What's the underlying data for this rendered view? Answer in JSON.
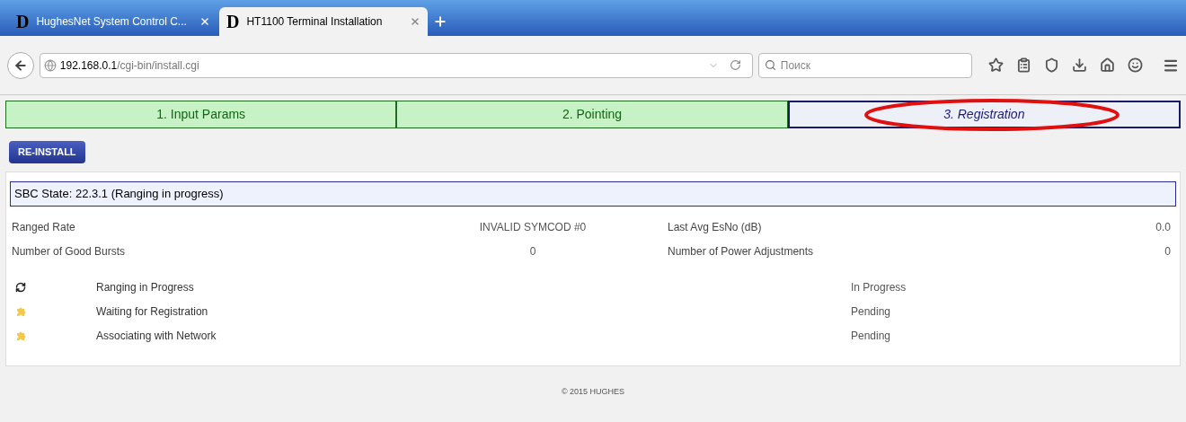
{
  "browser": {
    "tabs": [
      {
        "logo": "D",
        "title": "HughesNet System Control C...",
        "selected": false
      },
      {
        "logo": "D",
        "title": "HT1100 Terminal Installation",
        "selected": true
      }
    ],
    "address": {
      "host": "192.168.0.1",
      "path": "/cgi-bin/install.cgi"
    },
    "search": {
      "placeholder": "Поиск"
    }
  },
  "steps": [
    {
      "label": "1. Input Params",
      "selected": false
    },
    {
      "label": "2. Pointing",
      "selected": false
    },
    {
      "label": "3. Registration",
      "selected": true
    }
  ],
  "reinstall_button": "RE-INSTALL",
  "state_bar": "SBC State: 22.3.1 (Ranging in progress)",
  "stats": [
    {
      "label": "Ranged Rate",
      "value": "INVALID SYMCOD #0",
      "label_2": "Last Avg EsNo (dB)",
      "value_2": "0.0"
    },
    {
      "label": "Number of Good Bursts",
      "value": "0",
      "label_2": "Number of Power Adjustments",
      "value_2": "0"
    }
  ],
  "tasks": [
    {
      "kind": "in_progress",
      "name": "Ranging in Progress",
      "status": "In Progress"
    },
    {
      "kind": "pending",
      "name": "Waiting for Registration",
      "status": "Pending"
    },
    {
      "kind": "pending",
      "name": "Associating with Network",
      "status": "Pending"
    }
  ],
  "footer": "© 2015 HUGHES"
}
